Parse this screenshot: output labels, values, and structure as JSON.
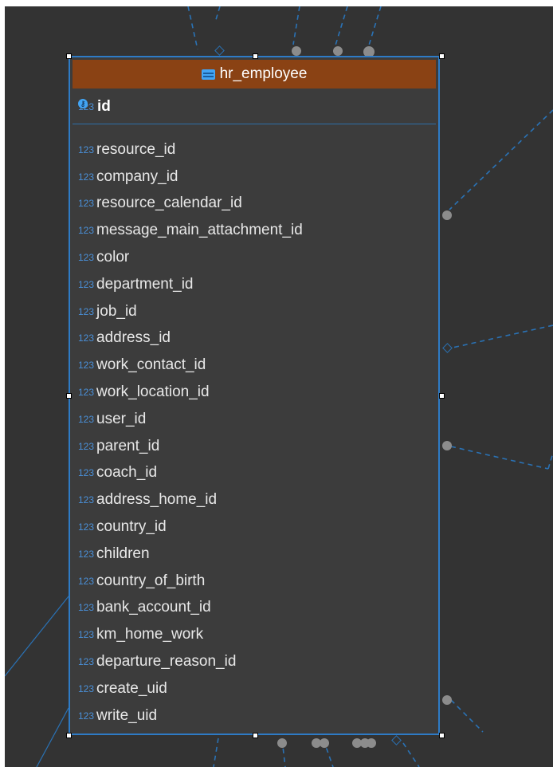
{
  "entity": {
    "title": "hr_employee",
    "header_color": "#8a4214",
    "border_color": "#2e7bc6",
    "type_icon": "123",
    "primary_key": "id",
    "columns": [
      "resource_id",
      "company_id",
      "resource_calendar_id",
      "message_main_attachment_id",
      "color",
      "department_id",
      "job_id",
      "address_id",
      "work_contact_id",
      "work_location_id",
      "user_id",
      "parent_id",
      "coach_id",
      "address_home_id",
      "country_id",
      "children",
      "country_of_birth",
      "bank_account_id",
      "km_home_work",
      "departure_reason_id",
      "create_uid",
      "write_uid"
    ]
  }
}
